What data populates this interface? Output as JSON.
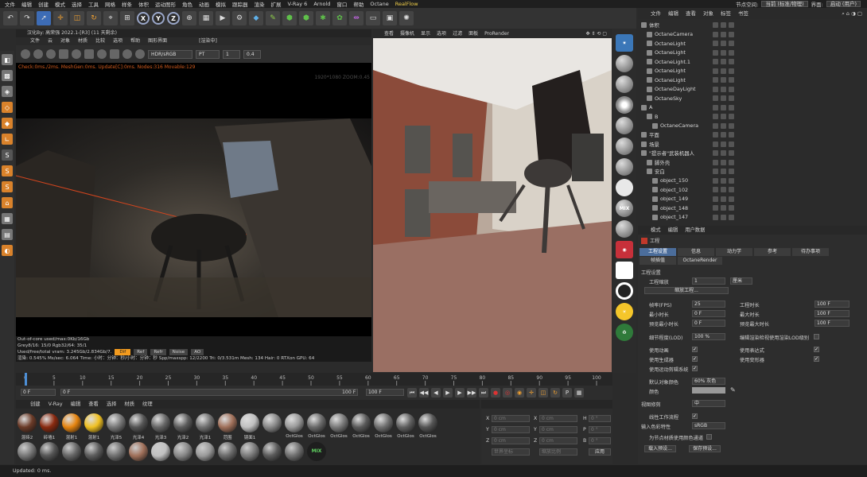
{
  "menubar": {
    "items": [
      "文件",
      "编辑",
      "创建",
      "模式",
      "选择",
      "工具",
      "网格",
      "样条",
      "体积",
      "运动图形",
      "角色",
      "动画",
      "模拟",
      "跟踪器",
      "渲染",
      "扩展",
      "V-Ray 6",
      "Arnold",
      "窗口",
      "帮助",
      "Octane",
      "RealFlow"
    ],
    "node_space_label": "节点空间:",
    "node_space_value": "当前 (标准/物理)",
    "interface_label": "界面:",
    "interface_value": "启动 (用户)"
  },
  "liveview": {
    "title": "汉化By: 高荣强 2022.1-[R3] (11 天剩余)",
    "menu": [
      "文件",
      "云",
      "对象",
      "材质",
      "比较",
      "选项",
      "帮助",
      "图形界面"
    ],
    "render_status": "[渲染中]",
    "color_space": "HDR/sRGB",
    "kernel": "PT",
    "val1": "1",
    "val2": "0.4",
    "status_line": "Check:0ms./2ms. MeshGen:0ms. Update[C]:0ms. Nodes:316 Movable:129",
    "resolution": "1920*1080 ZOOM:0.45",
    "info": [
      "Out-of-core used/max:0Kb/16Gb",
      "Grey8/16: 15/0      Rgb32/64: 35/1",
      "Used/free/total vram: 3.245Gb/2.834Gb/7.",
      "渲染: 0.545%    Ms/sec: 6.064    Time: 小时：分钟：秒/小时：分钟：秒    Spp/maxspp: 12/2200    Tri: 0/3.531m  Mesh: 134  Hair: 0    RTXon    GPU: 64"
    ],
    "passes": [
      "Dif",
      "Ref",
      "Refr",
      "Noise",
      "AO"
    ]
  },
  "viewport": {
    "menu": [
      "查看",
      "摄像机",
      "显示",
      "选项",
      "过滤",
      "面板",
      "ProRender"
    ]
  },
  "octane_bar": {
    "mix_label": "MIX"
  },
  "right_panel": {
    "menu": [
      "文件",
      "编辑",
      "查看",
      "对象",
      "标签",
      "书签"
    ]
  },
  "objects": [
    {
      "name": "体积",
      "indent": 0
    },
    {
      "name": "OctaneCamera",
      "indent": 1
    },
    {
      "name": "OctaneLight",
      "indent": 1
    },
    {
      "name": "OctaneLight",
      "indent": 1
    },
    {
      "name": "OctaneLight.1",
      "indent": 1
    },
    {
      "name": "OctaneLight",
      "indent": 1
    },
    {
      "name": "OctaneLight",
      "indent": 1
    },
    {
      "name": "OctaneDayLight",
      "indent": 1
    },
    {
      "name": "OctaneSky",
      "indent": 1
    },
    {
      "name": "A",
      "indent": 0
    },
    {
      "name": "B",
      "indent": 1
    },
    {
      "name": "OctaneCamera",
      "indent": 2
    },
    {
      "name": "平面",
      "indent": 0
    },
    {
      "name": "场景",
      "indent": 0
    },
    {
      "name": "\"提示者\"武装机器人",
      "indent": 0
    },
    {
      "name": "脚外壳",
      "indent": 1
    },
    {
      "name": "安白",
      "indent": 1
    },
    {
      "name": "object_150",
      "indent": 2
    },
    {
      "name": "object_102",
      "indent": 2
    },
    {
      "name": "object_149",
      "indent": 2
    },
    {
      "name": "object_148",
      "indent": 2
    },
    {
      "name": "object_147",
      "indent": 2
    }
  ],
  "attributes": {
    "menu": [
      "模式",
      "编辑",
      "用户数据"
    ],
    "title": "工程",
    "tabs_row1": [
      "工程设置",
      "信息",
      "动力学",
      "参考",
      "待办事项"
    ],
    "tabs_row2": [
      "帧插值",
      "OctaneRender"
    ],
    "section": "工程设置",
    "scale_label": "工程缩放",
    "scale_value": "1",
    "scale_unit": "厘米",
    "scale_btn": "缩放工程...",
    "fps_label": "帧率(FPS)",
    "fps_value": "25",
    "min_label": "最小时长",
    "min_value": "0 F",
    "preview_min_label": "预览最小时长",
    "preview_min_value": "0 F",
    "duration_label": "工程时长",
    "duration_value": "100 F",
    "max_label": "最大时长",
    "max_value": "100 F",
    "preview_max_label": "预览最大时长",
    "preview_max_value": "100 F",
    "lod_label": "细节程度(LOD)",
    "lod_value": "100 %",
    "lod_edit_label": "编辑渲染检视使用渲染LOD级别",
    "anim_label": "使用动画",
    "expr_label": "使用表达式",
    "gen_label": "使用生成器",
    "deform_label": "使用变形器",
    "motion_label": "使用运动剪辑系统",
    "default_color_label": "默认对象颜色",
    "default_color_value": "60% 灰色",
    "color_label": "颜色",
    "view_clip_label": "视图修剪",
    "view_clip_value": "中",
    "linear_label": "线性工作流程",
    "input_color_label": "输入色彩特性",
    "input_color_value": "sRGB",
    "node_mat_label": "为节点材质使用颜色通道",
    "load_preset": "载入预设...",
    "save_preset": "保存预设..."
  },
  "timeline": {
    "ticks": [
      "0",
      "5",
      "10",
      "15",
      "20",
      "25",
      "30",
      "35",
      "40",
      "45",
      "50",
      "55",
      "60",
      "65",
      "70",
      "75",
      "80",
      "85",
      "90",
      "95",
      "100"
    ],
    "current": "0 F",
    "start": "0 F",
    "end": "100 F",
    "end2": "100 F",
    "end3": "100 F"
  },
  "material_manager": {
    "menu": [
      "创建",
      "V-Ray",
      "编辑",
      "查看",
      "选择",
      "材质",
      "纹理"
    ],
    "row1": [
      "混砖2",
      "砖墙1",
      "混射1",
      "混射1",
      "光泽5",
      "光泽4",
      "光泽3",
      "光泽2",
      "光泽1",
      "范围",
      "镜面1",
      "",
      "OctGlos",
      "OctGlos",
      "OctGlos",
      "OctGlos",
      "OctGlos",
      "OctGlos",
      "OctGlos"
    ],
    "row2_mix": "MIX"
  },
  "coords": {
    "x_label": "X",
    "y_label": "Y",
    "z_label": "Z",
    "x": "0 cm",
    "y": "0 cm",
    "z": "0 cm",
    "h_label": "H",
    "p_label": "P",
    "b_label": "B",
    "h": "0 °",
    "p": "0 °",
    "b": "0 °",
    "world": "世界坐标",
    "scale": "缩放比例",
    "apply": "应用"
  },
  "statusbar": {
    "text": "Updated: 0 ms."
  }
}
